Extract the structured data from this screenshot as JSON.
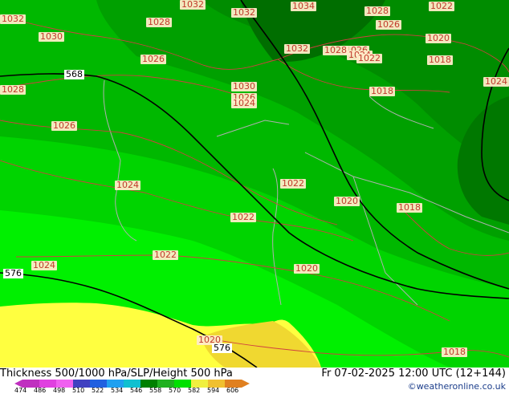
{
  "footer": {
    "title": "Thickness 500/1000 hPa/SLP/Height 500 hPa",
    "datetime": "Fr 07-02-2025 12:00 UTC (12+144)",
    "credit": "©weatheronline.co.uk"
  },
  "legend": {
    "ticks": [
      "474",
      "486",
      "498",
      "510",
      "522",
      "534",
      "546",
      "558",
      "570",
      "582",
      "594",
      "606"
    ],
    "colors": [
      "#c030c0",
      "#e040e0",
      "#f060f0",
      "#4040c0",
      "#2060e0",
      "#20a0f0",
      "#10c0d0",
      "#008000",
      "#20b020",
      "#00e000",
      "#f0f040",
      "#f0c030",
      "#e08020"
    ]
  },
  "map": {
    "colors": {
      "green_dark": "#006400",
      "green_mid": "#008c00",
      "green_light": "#00a800",
      "green_bright": "#00d400",
      "green_lime": "#00f000",
      "yellow": "#ffff40",
      "isobar_color": "#d04040",
      "height_line_color": "#000000",
      "border_color": "#b0b0b0"
    },
    "isobar_labels": [
      "1032",
      "1030",
      "1032",
      "1032",
      "1028",
      "1034",
      "1028",
      "1022",
      "1026",
      "1020",
      "1018",
      "1024",
      "1028",
      "1026",
      "1032",
      "1026",
      "1024",
      "1028",
      "1022",
      "1030",
      "1026",
      "1024",
      "1018",
      "1026",
      "1024",
      "1022",
      "1020",
      "1018",
      "1022",
      "1022",
      "1024",
      "1020",
      "1020",
      "1018"
    ],
    "height_labels": [
      "568",
      "576",
      "576"
    ]
  }
}
